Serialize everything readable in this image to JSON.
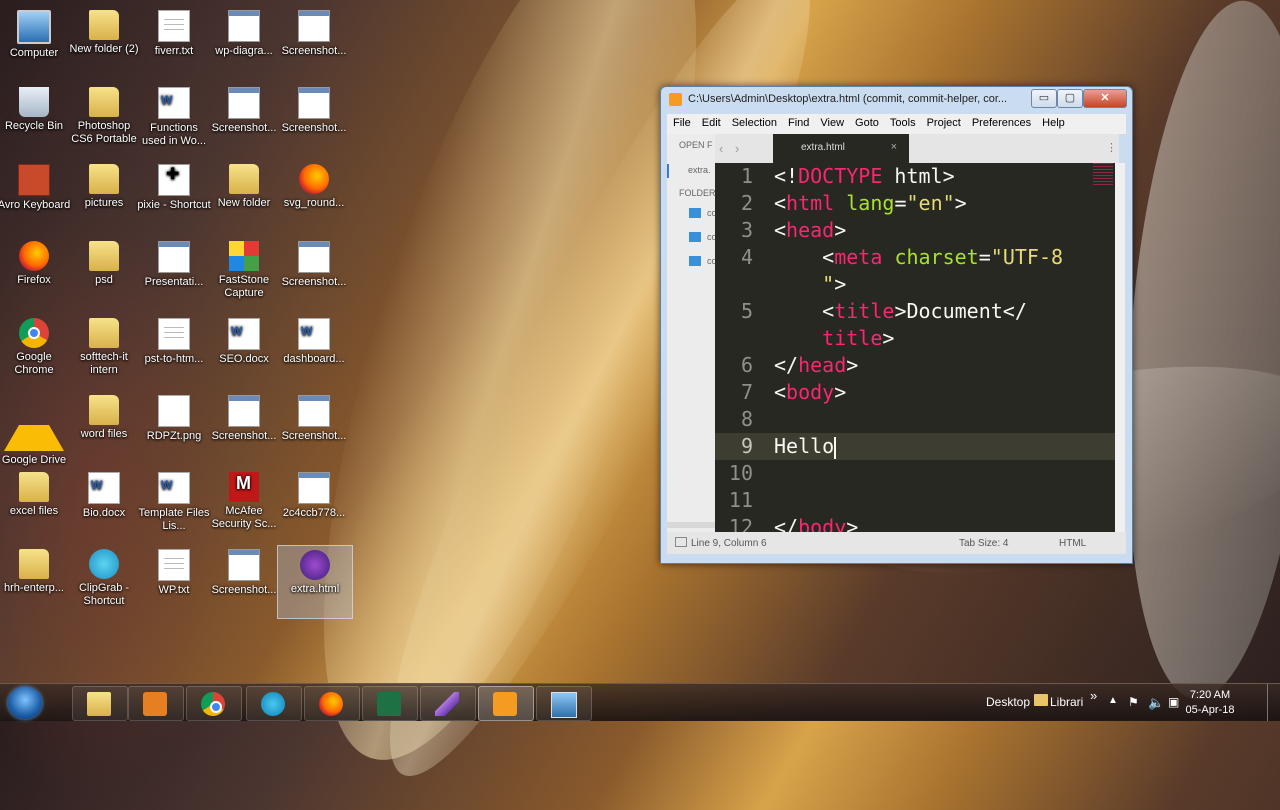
{
  "desktop": {
    "icons": [
      {
        "label": "Computer",
        "icon": "computer-icon"
      },
      {
        "label": "New folder (2)",
        "icon": "folder-icon"
      },
      {
        "label": "fiverr.txt",
        "icon": "text-file-icon"
      },
      {
        "label": "wp-diagra...",
        "icon": "image-file-icon"
      },
      {
        "label": "Screenshot...",
        "icon": "image-file-icon"
      },
      {
        "label": "Recycle Bin",
        "icon": "recycle-bin-icon"
      },
      {
        "label": "Photoshop CS6 Portable",
        "icon": "folder-icon"
      },
      {
        "label": "Functions used in Wo...",
        "icon": "word-doc-icon"
      },
      {
        "label": "Screenshot...",
        "icon": "image-file-icon"
      },
      {
        "label": "Screenshot...",
        "icon": "image-file-icon"
      },
      {
        "label": "Avro Keyboard",
        "icon": "avro-keyboard-icon"
      },
      {
        "label": "pictures",
        "icon": "folder-icon"
      },
      {
        "label": "pixie - Shortcut",
        "icon": "pixie-icon"
      },
      {
        "label": "New folder",
        "icon": "folder-icon"
      },
      {
        "label": "svg_round...",
        "icon": "firefox-file-icon"
      },
      {
        "label": "Firefox",
        "icon": "firefox-icon"
      },
      {
        "label": "psd",
        "icon": "folder-icon"
      },
      {
        "label": "Presentati...",
        "icon": "image-file-icon"
      },
      {
        "label": "FastStone Capture",
        "icon": "faststone-icon"
      },
      {
        "label": "Screenshot...",
        "icon": "image-file-icon"
      },
      {
        "label": "Google Chrome",
        "icon": "chrome-icon"
      },
      {
        "label": "softtech-it intern",
        "icon": "folder-icon"
      },
      {
        "label": "pst-to-htm...",
        "icon": "text-file-icon"
      },
      {
        "label": "SEO.docx",
        "icon": "word-doc-icon"
      },
      {
        "label": "dashboard...",
        "icon": "word-doc-icon"
      },
      {
        "label": "Google Drive",
        "icon": "google-drive-icon"
      },
      {
        "label": "word files",
        "icon": "folder-icon"
      },
      {
        "label": "RDPZt.png",
        "icon": "png-file-icon"
      },
      {
        "label": "Screenshot...",
        "icon": "image-file-icon"
      },
      {
        "label": "Screenshot...",
        "icon": "image-file-icon"
      },
      {
        "label": "excel files",
        "icon": "folder-icon"
      },
      {
        "label": "Bio.docx",
        "icon": "word-doc-icon"
      },
      {
        "label": "Template Files Lis...",
        "icon": "word-doc-icon"
      },
      {
        "label": "McAfee Security Sc...",
        "icon": "mcafee-icon"
      },
      {
        "label": "2c4ccb778...",
        "icon": "image-file-icon"
      },
      {
        "label": "hrh-enterp...",
        "icon": "folder-icon"
      },
      {
        "label": "ClipGrab - Shortcut",
        "icon": "clipgrab-icon"
      },
      {
        "label": "WP.txt",
        "icon": "text-file-icon"
      },
      {
        "label": "Screenshot...",
        "icon": "image-file-icon"
      },
      {
        "label": "extra.html",
        "icon": "html-file-icon"
      }
    ]
  },
  "window": {
    "title": "C:\\Users\\Admin\\Desktop\\extra.html (commit, commit-helper, cor...",
    "min_label": "▭",
    "max_label": "▢",
    "close_label": "✕",
    "menu": [
      "File",
      "Edit",
      "Selection",
      "Find",
      "View",
      "Goto",
      "Tools",
      "Project",
      "Preferences",
      "Help"
    ],
    "sidebar": {
      "open_files_label": "OPEN F",
      "open_file": "extra.",
      "folders_label": "FOLDER",
      "folders": [
        "co",
        "co",
        "co"
      ]
    },
    "tab": {
      "label": "extra.html",
      "close": "×"
    },
    "nav_back": "‹",
    "nav_fwd": "›",
    "tab_menu": "⋮",
    "line_numbers": [
      "1",
      "2",
      "3",
      "4",
      "",
      "5",
      "",
      "6",
      "7",
      "8",
      "9",
      "10",
      "11",
      "12"
    ],
    "code_lines": [
      "<!DOCTYPE html>",
      "<html lang=\"en\">",
      "<head>",
      "    <meta charset=\"UTF-8",
      "    \">",
      "    <title>Document</",
      "    title>",
      "</head>",
      "<body>",
      "",
      "Hello",
      "",
      "",
      "</body>"
    ],
    "status": {
      "position": "Line 9, Column 6",
      "tab_size": "Tab Size: 4",
      "syntax": "HTML"
    }
  },
  "taskbar": {
    "apps": [
      {
        "name": "explorer-icon"
      },
      {
        "name": "media-player-icon"
      },
      {
        "name": "chrome-icon"
      },
      {
        "name": "skype-icon"
      },
      {
        "name": "firefox-icon"
      },
      {
        "name": "excel-icon"
      },
      {
        "name": "feather-icon"
      },
      {
        "name": "sublime-text-icon"
      },
      {
        "name": "remote-desktop-icon"
      }
    ],
    "toolbar_desktop": "Desktop",
    "toolbar_libraries": "Librari",
    "toolbar_chevron": "»",
    "time": "7:20 AM",
    "date": "05-Apr-18"
  },
  "colors": {
    "editor_bg": "#272822",
    "keyword_tag": "#f92672",
    "attribute": "#a6e22e",
    "string": "#e6db74",
    "text": "#f8f8f2"
  }
}
